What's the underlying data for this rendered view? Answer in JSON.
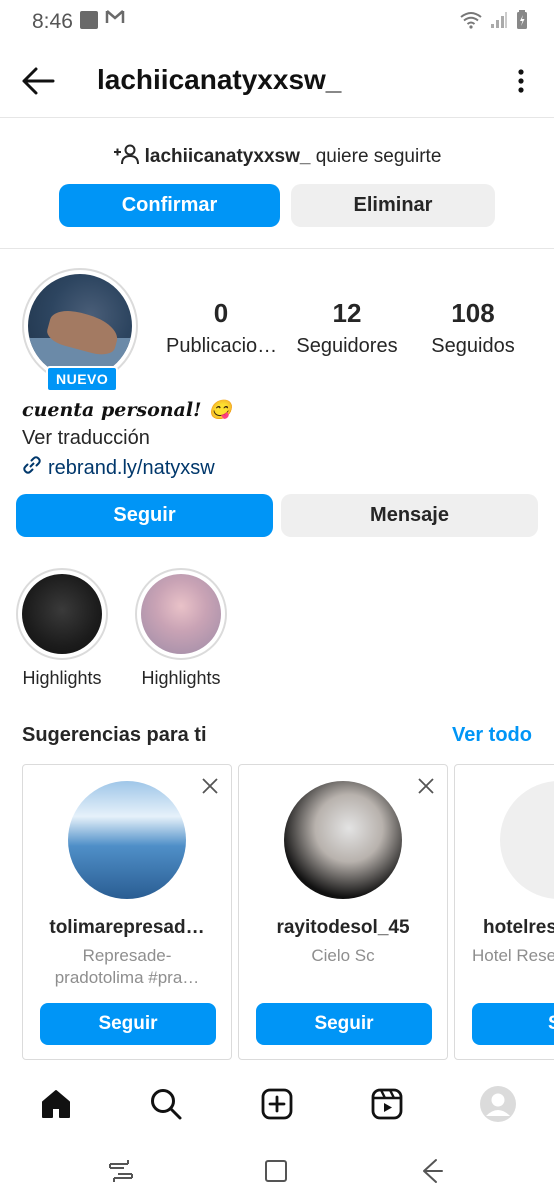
{
  "status_bar": {
    "time": "8:46"
  },
  "header": {
    "title": "lachiicanatyxxsw_"
  },
  "follow_request": {
    "username": "lachiicanatyxxsw_",
    "text": "quiere seguirte",
    "confirm_label": "Confirmar",
    "delete_label": "Eliminar"
  },
  "profile": {
    "badge": "NUEVO",
    "stats": [
      {
        "value": "0",
        "label": "Publicacio…"
      },
      {
        "value": "12",
        "label": "Seguidores"
      },
      {
        "value": "108",
        "label": "Seguidos"
      }
    ],
    "bio_name": "cuenta personal! 😋",
    "translate_label": "Ver traducción",
    "link": "rebrand.ly/natyxsw",
    "follow_label": "Seguir",
    "message_label": "Mensaje"
  },
  "highlights": [
    {
      "label": "Highlights"
    },
    {
      "label": "Highlights"
    }
  ],
  "suggestions": {
    "title": "Sugerencias para ti",
    "see_all": "Ver todo",
    "cards": [
      {
        "name": "tolimarepresad…",
        "sub": "Represade-\npradotolima #pra…",
        "button": "Seguir"
      },
      {
        "name": "rayitodesol_45",
        "sub": "Cielo Sc",
        "button": "Seguir"
      },
      {
        "name": "hotelres",
        "sub": "Hotel Rese",
        "button": "Se"
      }
    ]
  },
  "colors": {
    "accent": "#0095f6",
    "link": "#00376b"
  }
}
